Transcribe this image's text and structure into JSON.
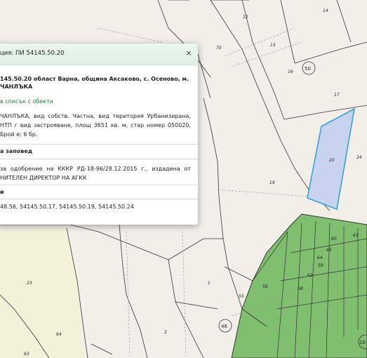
{
  "map": {
    "parcels": [
      {
        "id": "12",
        "label": "12"
      },
      {
        "id": "13",
        "label": "13"
      },
      {
        "id": "14",
        "label": "14"
      },
      {
        "id": "16",
        "label": "16"
      },
      {
        "id": "17",
        "label": "17"
      },
      {
        "id": "19",
        "label": "19"
      },
      {
        "id": "20",
        "label": "20",
        "selected": true
      },
      {
        "id": "24",
        "label": "24"
      },
      {
        "id": "70",
        "label": "70"
      },
      {
        "id": "1",
        "label": "1"
      },
      {
        "id": "2",
        "label": "2"
      },
      {
        "id": "23",
        "label": "23"
      },
      {
        "id": "55",
        "label": "55"
      },
      {
        "id": "56",
        "label": "56"
      },
      {
        "id": "58",
        "label": "58"
      },
      {
        "id": "59",
        "label": "59"
      },
      {
        "id": "60",
        "label": "60"
      },
      {
        "id": "61",
        "label": "61"
      },
      {
        "id": "62",
        "label": "62"
      },
      {
        "id": "63",
        "label": "63"
      },
      {
        "id": "64a",
        "label": "64"
      },
      {
        "id": "64b",
        "label": "64"
      },
      {
        "id": "65",
        "label": "65"
      }
    ],
    "circle_labels": [
      "50",
      "48",
      "10"
    ],
    "colors": {
      "background": "#f2efe9",
      "forest": "#7fbf6f",
      "selected_fill": "#c7d3ef",
      "selected_stroke": "#3aa0d8",
      "field": "#f3f2d8"
    }
  },
  "popup": {
    "title": "ция: ПИ 54145.50.20",
    "close": "×",
    "address": "145.50.20 област Варна, община Аксаково, с. Осеново, м.\nЧАНЛЪКА",
    "add_to_list": "в списък с обекти",
    "description": "ЧАНЛЪКА, вид собств. Частна, вид територия Урбанизирана, НТП г вид застрояване, площ 3651 кв. м, стар номер 050020, Брой е: 6 бр.",
    "section_order": "а заповед",
    "order_text": "за одобрение на КККР РД-18-96/28.12.2015 г., издадена от НИТЕЛЕН ДИРЕКТОР НА АГКК",
    "section_neighbors": "и",
    "neighbors": "48.56, 54145.50.17, 54145.50.19, 54145.50.24"
  }
}
